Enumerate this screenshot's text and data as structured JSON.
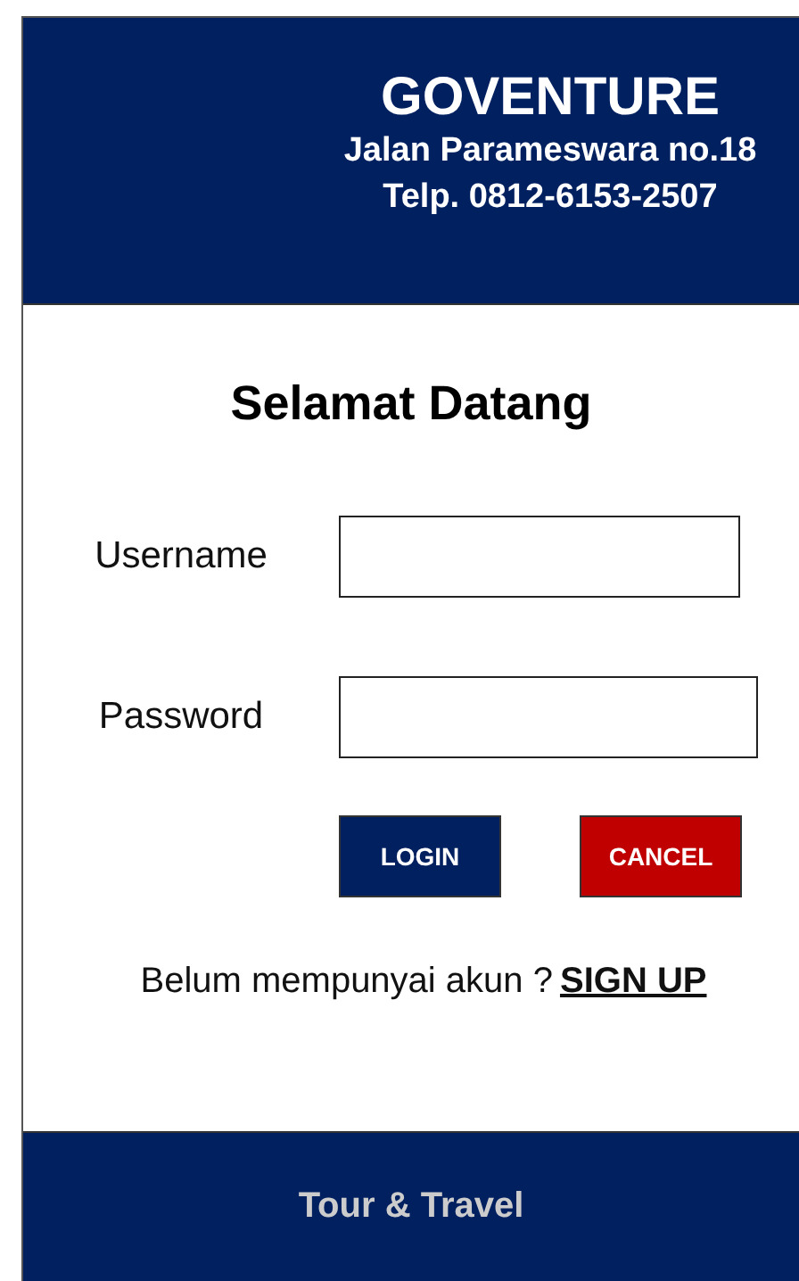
{
  "header": {
    "brand": "GOVENTURE",
    "address": "Jalan Parameswara no.18",
    "phone": "Telp. 0812-6153-2507"
  },
  "form": {
    "title": "Selamat Datang",
    "fields": [
      {
        "label": "Username"
      },
      {
        "label": "Password"
      }
    ],
    "buttons": [
      {
        "label": "LOGIN",
        "kind": "primary"
      },
      {
        "label": "CANCEL",
        "kind": "danger"
      }
    ],
    "signup": {
      "prompt": "Belum mempunyai akun ?",
      "link": "SIGN UP"
    }
  },
  "footer": {
    "text": "Tour & Travel"
  }
}
